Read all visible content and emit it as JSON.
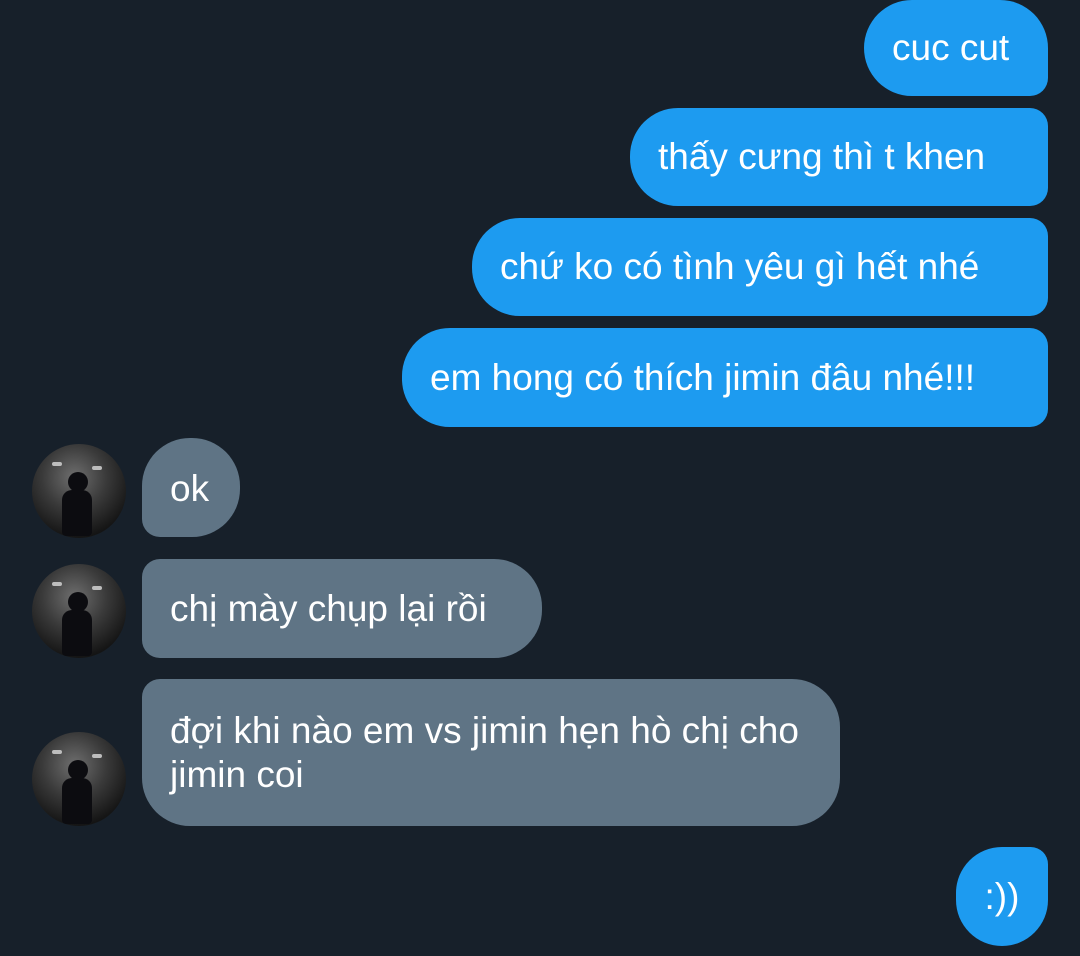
{
  "messages": [
    {
      "direction": "sent",
      "text": "cuc cut"
    },
    {
      "direction": "sent",
      "text": "thấy cưng thì t khen"
    },
    {
      "direction": "sent",
      "text": "chứ ko có tình yêu gì hết nhé"
    },
    {
      "direction": "sent",
      "text": "em hong có thích jimin đâu nhé!!!"
    },
    {
      "direction": "received",
      "text": "ok"
    },
    {
      "direction": "received",
      "text": "chị mày chụp lại rồi"
    },
    {
      "direction": "received",
      "text": "đợi khi nào em vs jimin hẹn hò chị cho jimin coi"
    },
    {
      "direction": "sent",
      "text": ":))"
    }
  ],
  "colors": {
    "background": "#17202a",
    "sent_bubble": "#1d9bf0",
    "received_bubble": "#5f7485",
    "text": "#ffffff"
  },
  "icons": {
    "avatar": "profile-photo-avatar"
  }
}
